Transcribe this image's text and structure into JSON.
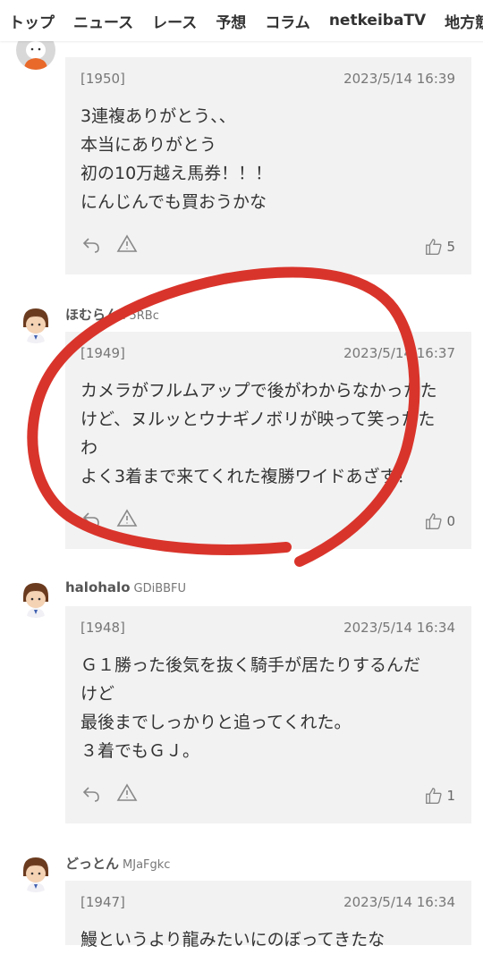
{
  "nav": {
    "items": [
      "トップ",
      "ニュース",
      "レース",
      "予想",
      "コラム",
      "netkeibaTV",
      "地方競"
    ]
  },
  "comments": [
    {
      "user": "",
      "uid": "",
      "num": "[1950]",
      "date": "2023/5/14 16:39",
      "lines": [
        "3連複ありがとう、、",
        "本当にありがとう",
        "初の10万越え馬券！！！",
        "にんじんでも買おうかな"
      ],
      "likes": "5"
    },
    {
      "user": "ほむらん",
      "uid": "F5RBc",
      "num": "[1949]",
      "date": "2023/5/14 16:37",
      "lines": [
        "カメラがフルムアップで後がわからなかったた",
        "けど、ヌルッとウナギノボリが映って笑ったた",
        "わ",
        "よく3着まで来てくれた複勝ワイドあざす！"
      ],
      "likes": "0"
    },
    {
      "user": "halohalo",
      "uid": "GDiBBFU",
      "num": "[1948]",
      "date": "2023/5/14 16:34",
      "lines": [
        "Ｇ１勝った後気を抜く騎手が居たりするんだ",
        "けど",
        "最後までしっかりと追ってくれた。",
        "３着でもＧＪ。"
      ],
      "likes": "1"
    },
    {
      "user": "どっとん",
      "uid": "MJaFgkc",
      "num": "[1947]",
      "date": "2023/5/14 16:34",
      "lines": [
        "鰻というより龍みたいにのぼってきたな"
      ],
      "likes": ""
    }
  ],
  "annotation": {
    "color": "#d9342b"
  }
}
